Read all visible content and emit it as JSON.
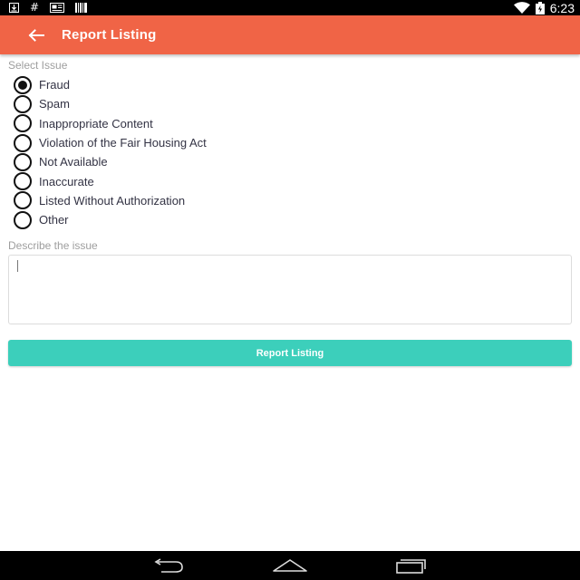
{
  "status_bar": {
    "left_icons": [
      "download-icon",
      "hash-icon",
      "news-icon",
      "barcode-icon"
    ],
    "right_icons": [
      "wifi-icon",
      "battery-icon"
    ],
    "time": "6:23"
  },
  "app_bar": {
    "title": "Report Listing",
    "color": "#f06446"
  },
  "issue_section": {
    "label": "Select Issue",
    "selected_index": 0,
    "options": [
      "Fraud",
      "Spam",
      "Inappropriate Content",
      "Violation of the Fair Housing Act",
      "Not Available",
      "Inaccurate",
      "Listed Without Authorization",
      "Other"
    ]
  },
  "describe_section": {
    "label": "Describe the issue",
    "value": ""
  },
  "submit": {
    "label": "Report Listing",
    "color": "#3ccfbb"
  },
  "nav_bar": {
    "buttons": [
      "back-nav-icon",
      "home-nav-icon",
      "recents-nav-icon"
    ]
  }
}
